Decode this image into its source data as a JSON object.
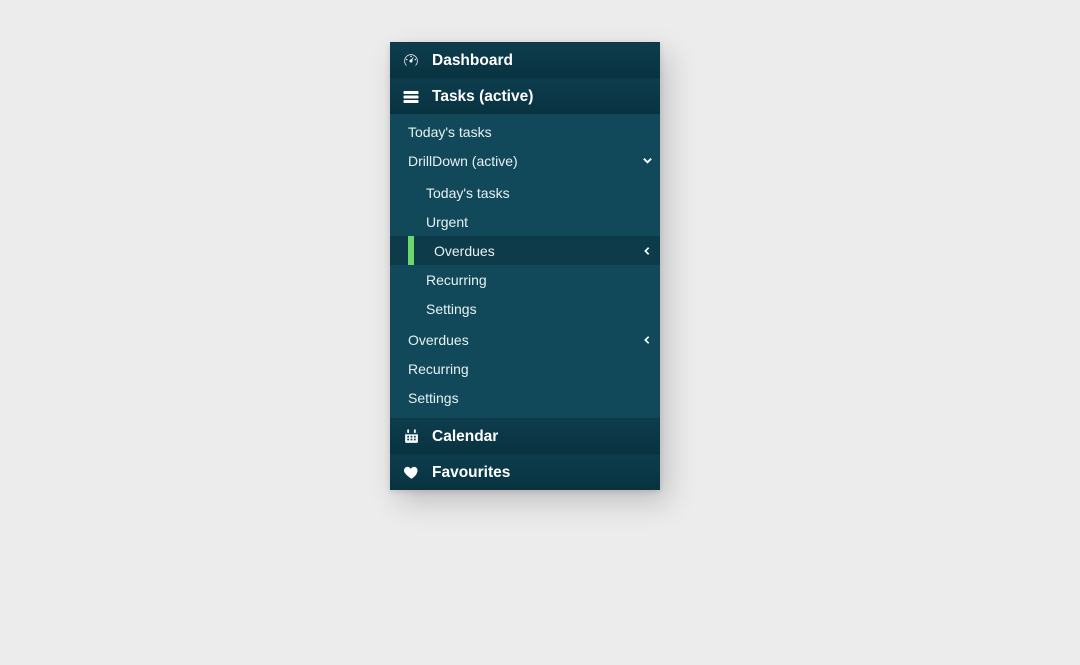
{
  "nav": {
    "items": [
      {
        "label": "Dashboard",
        "icon": "dashboard"
      },
      {
        "label": "Tasks (active)",
        "icon": "tasks"
      },
      {
        "label": "Calendar",
        "icon": "calendar"
      },
      {
        "label": "Favourites",
        "icon": "heart"
      }
    ],
    "tasks_children": [
      {
        "label": "Today's tasks"
      },
      {
        "label": "DrillDown (active)",
        "expand": "down"
      },
      {
        "label": "Overdues",
        "expand": "left"
      },
      {
        "label": "Recurring"
      },
      {
        "label": "Settings"
      }
    ],
    "drilldown_children": [
      {
        "label": "Today's tasks"
      },
      {
        "label": "Urgent"
      },
      {
        "label": "Overdues",
        "active": true,
        "expand": "left"
      },
      {
        "label": "Recurring"
      },
      {
        "label": "Settings"
      }
    ]
  },
  "colors": {
    "accent_bar": "#6cd86c",
    "panel_bg": "#0c3c4c",
    "sub_bg": "#12495a"
  }
}
